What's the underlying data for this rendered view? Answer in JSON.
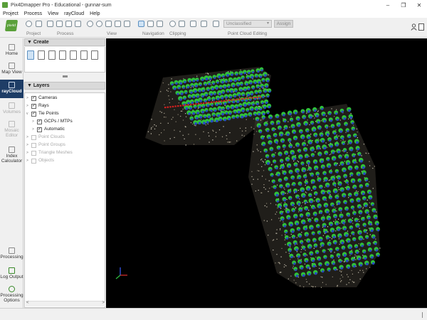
{
  "window": {
    "title": "Pix4Dmapper Pro - Educational - gunnar-sum",
    "controls": {
      "minimize": "–",
      "restore": "❐",
      "close": "✕"
    }
  },
  "menu": [
    "Project",
    "Process",
    "View",
    "rayCloud",
    "Help"
  ],
  "toolbar": {
    "logo_text": "pix4d",
    "groups": [
      "Project",
      "Process",
      "View",
      "Navigation",
      "Clipping",
      "Point Cloud Editing"
    ],
    "class_select": "Unclassified",
    "assign_label": "Assign"
  },
  "leftnav": {
    "items": [
      {
        "label": "Home",
        "icon": "home-icon"
      },
      {
        "label": "Map View",
        "icon": "map-icon"
      },
      {
        "label": "rayCloud",
        "icon": "raycloud-icon"
      },
      {
        "label": "Volumes",
        "icon": "volumes-icon"
      },
      {
        "label1": "Mosaic",
        "label2": "Editor",
        "icon": "mosaic-icon"
      },
      {
        "label1": "Index",
        "label2": "Calculator",
        "icon": "index-icon"
      },
      {
        "label": "Processing",
        "icon": "processing-icon"
      },
      {
        "label": "Log Output",
        "icon": "log-icon"
      },
      {
        "label1": "Processing",
        "label2": "Options",
        "icon": "gear-icon"
      }
    ]
  },
  "panel": {
    "create_header": "Create",
    "layers_header": "Layers",
    "layers": [
      {
        "label": "Cameras",
        "checked": "✓"
      },
      {
        "label": "Rays",
        "checked": "✓"
      },
      {
        "label": "Tie Points",
        "checked": "✓"
      },
      {
        "label": "GCPs / MTPs",
        "checked": "✓"
      },
      {
        "label": "Automatic",
        "checked": "✓"
      },
      {
        "label": "Point Clouds",
        "checked": ""
      },
      {
        "label": "Point Groups",
        "checked": ""
      },
      {
        "label": "Triangle Meshes",
        "checked": ""
      },
      {
        "label": "Objects",
        "checked": ""
      }
    ]
  },
  "viewport": {
    "cloud_colors": {
      "ground": "#c8c2b2",
      "camera_green": "#2fc23a",
      "camera_blue": "#2747c4",
      "ray_red": "#d42020"
    }
  }
}
